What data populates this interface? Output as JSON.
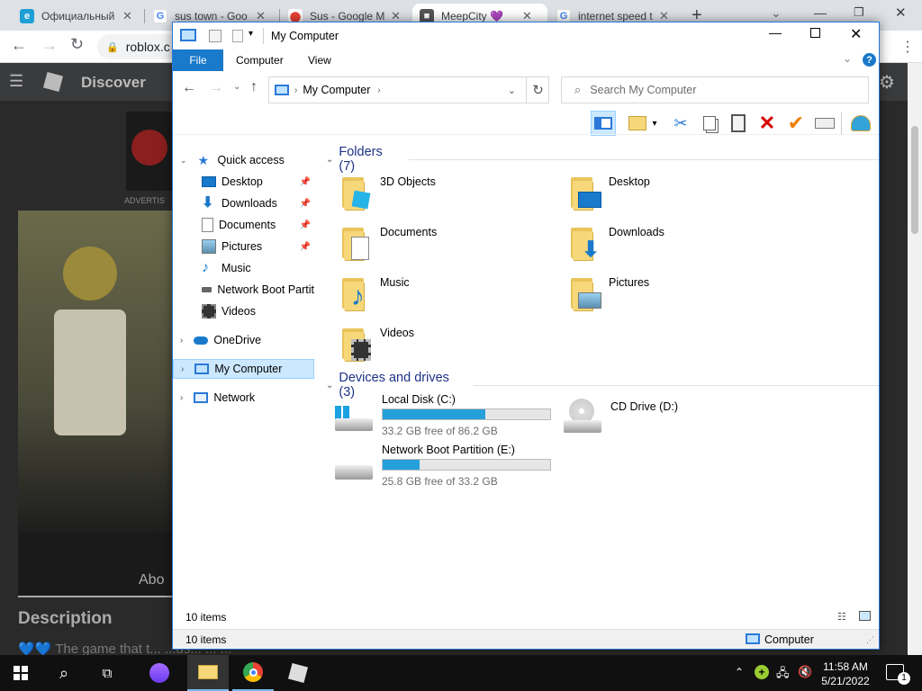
{
  "browser": {
    "tabs": [
      {
        "label": "Официальный",
        "favicon": "edge-e"
      },
      {
        "label": "sus town - Goo",
        "favicon": "google-g"
      },
      {
        "label": "Sus - Google M",
        "favicon": "maps-pin"
      },
      {
        "label": "MeepCity 💜",
        "favicon": "roblox"
      },
      {
        "label": "internet speed t",
        "favicon": "google-g"
      }
    ],
    "new_tab": "+",
    "url": "roblox.c"
  },
  "roblox": {
    "discover": "Discover",
    "advert": "ADVERTIS",
    "about": "Abo",
    "description": "Description",
    "desc_text": "💙💙 The game that t... ...ds... ... ..."
  },
  "explorer": {
    "title": "My Computer",
    "ribbon_tabs": [
      "File",
      "Computer",
      "View"
    ],
    "address": "My Computer",
    "search_placeholder": "Search My Computer",
    "nav": {
      "quick_access": "Quick access",
      "quick_items": [
        {
          "label": "Desktop",
          "pinned": true
        },
        {
          "label": "Downloads",
          "pinned": true
        },
        {
          "label": "Documents",
          "pinned": true
        },
        {
          "label": "Pictures",
          "pinned": true
        },
        {
          "label": "Music",
          "pinned": false
        },
        {
          "label": "Network Boot Partit",
          "pinned": false
        },
        {
          "label": "Videos",
          "pinned": false
        }
      ],
      "onedrive": "OneDrive",
      "my_computer": "My Computer",
      "network": "Network"
    },
    "folders_header": "Folders (7)",
    "folders": [
      "3D Objects",
      "Desktop",
      "Documents",
      "Downloads",
      "Music",
      "Pictures",
      "Videos"
    ],
    "devices_header": "Devices and drives (3)",
    "drives": [
      {
        "name": "Local Disk (C:)",
        "free": "33.2 GB free of 86.2 GB",
        "used_fraction": 0.615
      },
      {
        "name": "Network Boot Partition (E:)",
        "free": "25.8 GB free of 33.2 GB",
        "used_fraction": 0.223
      },
      {
        "name": "CD Drive (D:)"
      }
    ],
    "status_items": "10 items",
    "status_items2": "10 items",
    "status_location": "Computer"
  },
  "taskbar": {
    "time": "11:58 AM",
    "date": "5/21/2022",
    "notif_count": "1"
  }
}
